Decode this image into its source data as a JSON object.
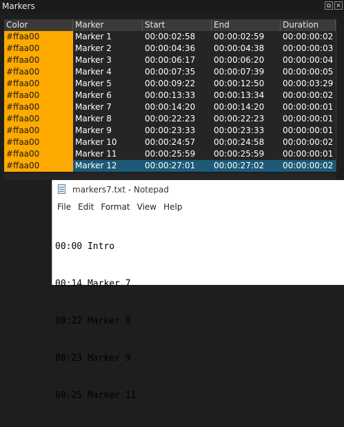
{
  "panel": {
    "title": "Markers",
    "float_icon": "float-icon",
    "close_icon": "close-icon"
  },
  "table": {
    "headers": [
      "Color",
      "Marker",
      "Start",
      "End",
      "Duration"
    ],
    "rows": [
      {
        "color": "#ffaa00",
        "name": "Marker 1",
        "start": "00:00:02:58",
        "end": "00:00:02:59",
        "duration": "00:00:00:02"
      },
      {
        "color": "#ffaa00",
        "name": "Marker 2",
        "start": "00:00:04:36",
        "end": "00:00:04:38",
        "duration": "00:00:00:03"
      },
      {
        "color": "#ffaa00",
        "name": "Marker 3",
        "start": "00:00:06:17",
        "end": "00:00:06:20",
        "duration": "00:00:00:04"
      },
      {
        "color": "#ffaa00",
        "name": "Marker 4",
        "start": "00:00:07:35",
        "end": "00:00:07:39",
        "duration": "00:00:00:05"
      },
      {
        "color": "#ffaa00",
        "name": "Marker 5",
        "start": "00:00:09:22",
        "end": "00:00:12:50",
        "duration": "00:00:03:29"
      },
      {
        "color": "#ffaa00",
        "name": "Marker 6",
        "start": "00:00:13:33",
        "end": "00:00:13:34",
        "duration": "00:00:00:02"
      },
      {
        "color": "#ffaa00",
        "name": "Marker 7",
        "start": "00:00:14:20",
        "end": "00:00:14:20",
        "duration": "00:00:00:01"
      },
      {
        "color": "#ffaa00",
        "name": "Marker 8",
        "start": "00:00:22:23",
        "end": "00:00:22:23",
        "duration": "00:00:00:01"
      },
      {
        "color": "#ffaa00",
        "name": "Marker 9",
        "start": "00:00:23:33",
        "end": "00:00:23:33",
        "duration": "00:00:00:01"
      },
      {
        "color": "#ffaa00",
        "name": "Marker 10",
        "start": "00:00:24:57",
        "end": "00:00:24:58",
        "duration": "00:00:00:02"
      },
      {
        "color": "#ffaa00",
        "name": "Marker 11",
        "start": "00:00:25:59",
        "end": "00:00:25:59",
        "duration": "00:00:00:01"
      },
      {
        "color": "#ffaa00",
        "name": "Marker 12",
        "start": "00:00:27:01",
        "end": "00:00:27:02",
        "duration": "00:00:00:02",
        "selected": true
      }
    ],
    "selected_row_color": "#1d5a78"
  },
  "notepad": {
    "title": "markers7.txt - Notepad",
    "icon": "notepad-icon",
    "menu": [
      "File",
      "Edit",
      "Format",
      "View",
      "Help"
    ],
    "lines": [
      "00:00 Intro",
      "00:14 Marker 7",
      "00:22 Marker 8",
      "00:23 Marker 9",
      "00:25 Marker 11"
    ]
  }
}
